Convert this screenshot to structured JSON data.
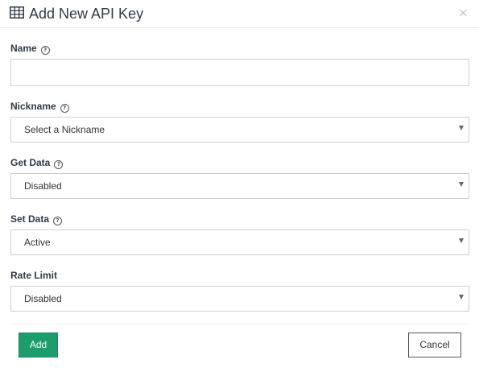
{
  "dialog": {
    "title": "Add New API Key",
    "title_icon": "table-icon",
    "close_icon": "close-icon",
    "close_glyph": "×"
  },
  "help_glyph": "?",
  "fields": {
    "name": {
      "label": "Name",
      "has_help": true,
      "value": "",
      "placeholder": ""
    },
    "nickname": {
      "label": "Nickname",
      "has_help": true,
      "selected": "Select a Nickname"
    },
    "get_data": {
      "label": "Get Data",
      "has_help": true,
      "selected": "Disabled"
    },
    "set_data": {
      "label": "Set Data",
      "has_help": true,
      "selected": "Active"
    },
    "rate_limit": {
      "label": "Rate Limit",
      "has_help": false,
      "selected": "Disabled"
    }
  },
  "buttons": {
    "add": "Add",
    "cancel": "Cancel"
  },
  "colors": {
    "primary": "#1e9d6c",
    "label": "#2f3a45",
    "border": "#cfcfcf"
  }
}
